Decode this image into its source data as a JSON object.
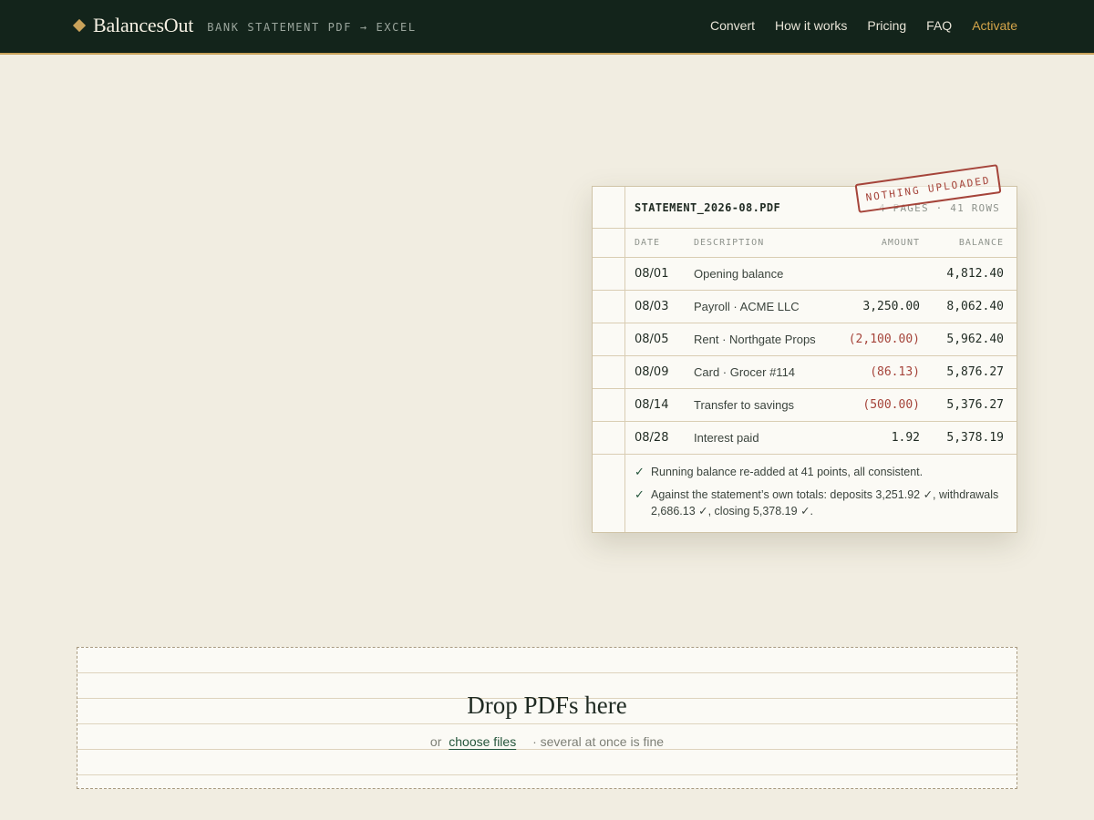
{
  "header": {
    "brand": "BalancesOut",
    "tagline": "BANK STATEMENT PDF → EXCEL",
    "nav": [
      {
        "label": "Convert"
      },
      {
        "label": "How it works"
      },
      {
        "label": "Pricing"
      },
      {
        "label": "FAQ"
      },
      {
        "label": "Activate"
      }
    ]
  },
  "statement": {
    "filename": "STATEMENT_2026-08.PDF",
    "page_info": "4 PAGES · 41 ROWS",
    "stamp": "NOTHING UPLOADED",
    "columns": {
      "date": "DATE",
      "description": "DESCRIPTION",
      "amount": "AMOUNT",
      "balance": "BALANCE"
    },
    "rows": [
      {
        "date": "08/01",
        "description": "Opening balance",
        "amount": "",
        "balance": "4,812.40"
      },
      {
        "date": "08/03",
        "description": "Payroll · ACME LLC",
        "amount": "3,250.00",
        "balance": "8,062.40"
      },
      {
        "date": "08/05",
        "description": "Rent · Northgate Props",
        "amount": "(2,100.00)",
        "balance": "5,962.40"
      },
      {
        "date": "08/09",
        "description": "Card · Grocer #114",
        "amount": "(86.13)",
        "balance": "5,876.27"
      },
      {
        "date": "08/14",
        "description": "Transfer to savings",
        "amount": "(500.00)",
        "balance": "5,376.27"
      },
      {
        "date": "08/28",
        "description": "Interest paid",
        "amount": "1.92",
        "balance": "5,378.19"
      }
    ],
    "checks": [
      "Running balance re-added at 41 points, all consistent.",
      "Against the statement’s own totals: deposits 3,251.92 ✓, withdrawals 2,686.13 ✓, closing 5,378.19 ✓."
    ],
    "check_mark": "✓"
  },
  "dropzone": {
    "title": "Drop PDFs here",
    "or": "or",
    "link": "choose files",
    "note": "· several at once is fine"
  },
  "colors": {
    "header_bg": "#13241b",
    "accent": "#c9a25a",
    "negative": "#a5443a",
    "positive_mark": "#24553b"
  }
}
